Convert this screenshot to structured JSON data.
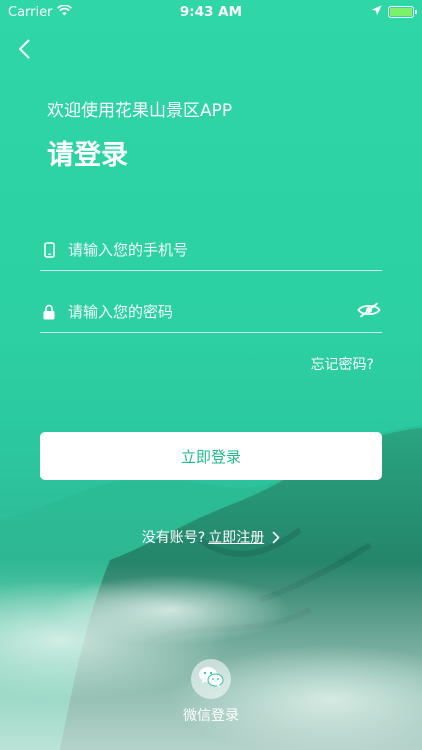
{
  "status_bar": {
    "carrier": "Carrier",
    "time": "9:43 AM",
    "battery_level": 1.0
  },
  "nav": {
    "back_icon": "chevron-left-icon"
  },
  "header": {
    "welcome": "欢迎使用花果山景区APP",
    "title": "请登录"
  },
  "form": {
    "phone": {
      "icon": "phone-icon",
      "placeholder": "请输入您的手机号",
      "value": ""
    },
    "password": {
      "icon": "lock-icon",
      "placeholder": "请输入您的密码",
      "value": "",
      "toggle_icon": "eye-hidden-icon"
    },
    "forgot_label": "忘记密码?",
    "login_label": "立即登录"
  },
  "register": {
    "prompt": "没有账号?",
    "link_label": "立即注册"
  },
  "social": {
    "wechat_label": "微信登录",
    "wechat_icon": "wechat-icon"
  },
  "colors": {
    "accent": "#2fd6a6",
    "button_text": "#21b98c"
  }
}
